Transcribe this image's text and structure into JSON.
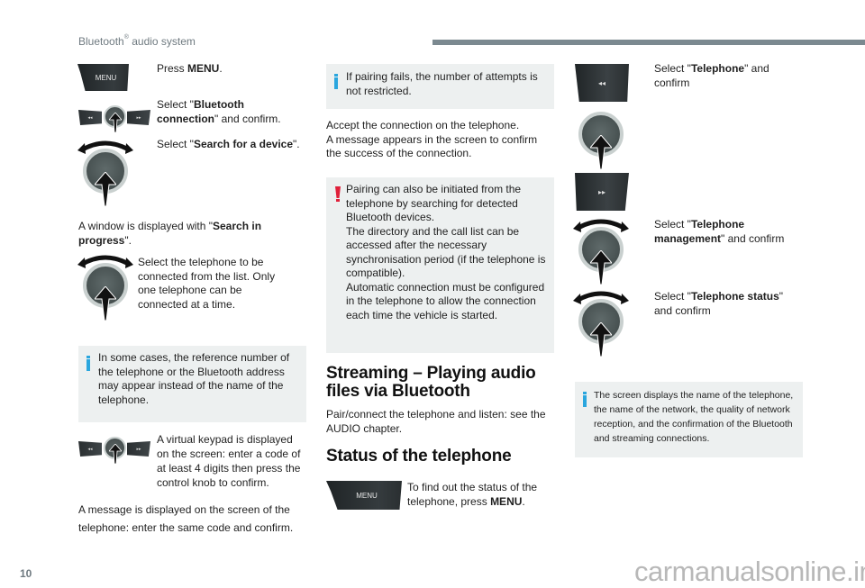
{
  "header": {
    "title": "Bluetooth",
    "title_sup": "®",
    "title_rest": " audio system"
  },
  "page_number": "10",
  "watermark": "carmanualsonline.info",
  "icons": {
    "menu_label": "MENU",
    "rewind_glyph": "◂◂",
    "forward_glyph": "▸▸"
  },
  "col1": {
    "step_menu": {
      "pre": "Press ",
      "bold": "MENU",
      "post": "."
    },
    "step_bt": {
      "pre": "Select \"",
      "bold": "Bluetooth connection",
      "post": "\" and confirm."
    },
    "step_search": {
      "pre": "Select \"",
      "bold": "Search for a device",
      "post": "\"."
    },
    "window_msg": {
      "pre": "A window is displayed with \"",
      "bold": "Search in progress",
      "post": "\"."
    },
    "select_phone": "Select the telephone to be connected from the list. Only one telephone can be connected at a time.",
    "info_box": "In some cases, the reference number of the telephone or the Bluetooth address may appear instead of the name of the telephone.",
    "keypad": "A virtual keypad is displayed on the screen: enter a code of at least 4 digits then press the control knob to confirm.",
    "message": "A message is displayed on the screen of the telephone: enter the same code and confirm."
  },
  "col2": {
    "info_box": "If pairing fails, the number of attempts is not restricted.",
    "accept": "Accept the connection on the telephone.\nA message appears in the screen to confirm the success of the connection.",
    "warning_lines": [
      "Pairing can also be initiated from the telephone by searching for detected Bluetooth devices.",
      "The directory and the call list can be accessed after the necessary synchronisation period (if the telephone is compatible).",
      "Automatic connection must be configured in the telephone to allow the connection each time the vehicle is started."
    ],
    "streaming_heading": "Streaming – Playing audio files via Bluetooth",
    "streaming_text": "Pair/connect the telephone and listen: see the AUDIO chapter.",
    "status_heading": "Status of the telephone",
    "status_step": {
      "pre": "To find out the status of the telephone, press ",
      "bold": "MENU",
      "post": "."
    }
  },
  "col3": {
    "step_telephone": {
      "pre": "Select \"",
      "bold": "Telephone",
      "post": "\" and confirm"
    },
    "step_management": {
      "pre": "Select \"",
      "bold": "Telephone management",
      "post": "\" and confirm"
    },
    "step_status": {
      "pre": "Select \"",
      "bold": "Telephone status",
      "post": "\" and confirm"
    },
    "info_box": "The screen displays the name of the telephone, the name of the network, the quality of network reception, and the confirmation of the Bluetooth and streaming connections."
  },
  "colors": {
    "info_accent": "#2aa6de",
    "warning_accent": "#e0203a",
    "box_bg": "#edf0f0",
    "header_bar": "#7b8990"
  }
}
